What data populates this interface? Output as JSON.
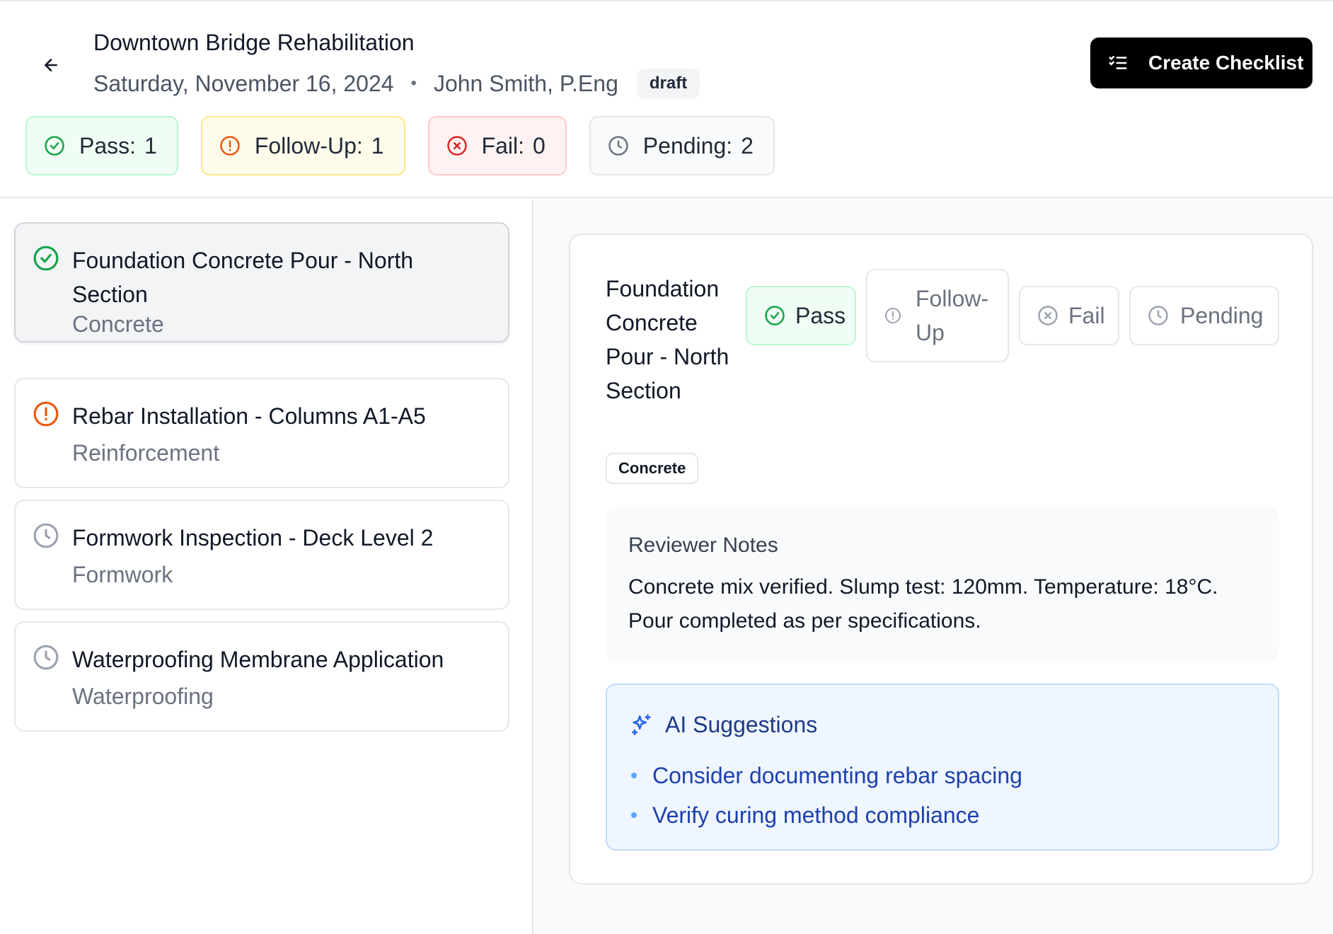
{
  "header": {
    "title": "Downtown Bridge Rehabilitation",
    "date": "Saturday, November 16, 2024",
    "separator": "•",
    "inspector": "John Smith, P.Eng",
    "status_badge": "draft",
    "create_button": "Create Checklist"
  },
  "summary": {
    "pass": {
      "label": "Pass:",
      "count": "1",
      "color": "#16a34a"
    },
    "follow_up": {
      "label": "Follow-Up:",
      "count": "1",
      "color": "#ea580c"
    },
    "fail": {
      "label": "Fail:",
      "count": "0",
      "color": "#dc2626"
    },
    "pending": {
      "label": "Pending:",
      "count": "2",
      "color": "#6b7280"
    }
  },
  "items": [
    {
      "name": "Foundation Concrete Pour - North Section",
      "category": "Concrete",
      "status": "pass",
      "icon": "check-circle-icon"
    },
    {
      "name": "Rebar Installation - Columns A1-A5",
      "category": "Reinforcement",
      "status": "follow-up",
      "icon": "alert-circle-icon"
    },
    {
      "name": "Formwork Inspection - Deck Level 2",
      "category": "Formwork",
      "status": "pending",
      "icon": "clock-icon"
    },
    {
      "name": "Waterproofing Membrane Application",
      "category": "Waterproofing",
      "status": "pending",
      "icon": "clock-icon"
    }
  ],
  "detail": {
    "title": "Foundation Concrete Pour - North Section",
    "category": "Concrete",
    "status_buttons": {
      "pass": "Pass",
      "follow_up": "Follow-Up",
      "fail": "Fail",
      "pending": "Pending"
    },
    "selected_status": "Pass",
    "notes_heading": "Reviewer Notes",
    "notes_text": "Concrete mix verified. Slump test: 120mm. Temperature: 18°C. Pour completed as per specifications.",
    "ai_heading": "AI Suggestions",
    "ai_suggestions": [
      "Consider documenting rebar spacing",
      "Verify curing method compliance"
    ]
  }
}
